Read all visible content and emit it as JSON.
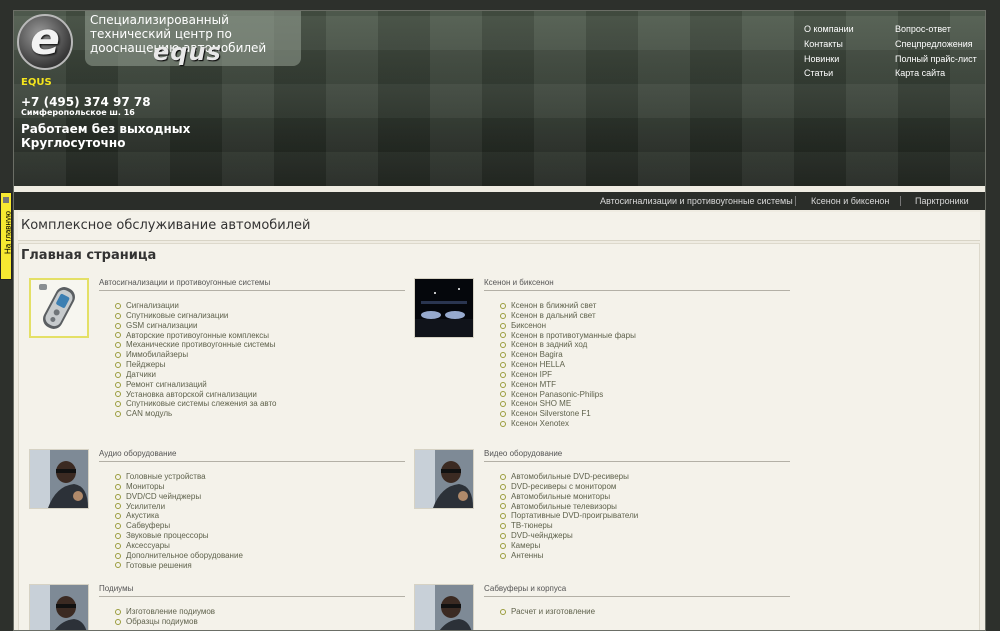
{
  "brand": {
    "logo_letter": "e",
    "tagline": "Специализированный технический центр по дооснащению автомобилей",
    "logo_word": "equs",
    "small_name": "EQUS"
  },
  "contact": {
    "phone": "+7 (495) 374 97 78",
    "address": "Симферопольское ш. 16",
    "hours_line1": "Работаем без выходных",
    "hours_line2": "Круглосуточно"
  },
  "top_nav": [
    "О компании",
    "Вопрос-ответ",
    "Контакты",
    "Спецпредложения",
    "Новинки",
    "Полный прайс-лист",
    "Статьи",
    "Карта сайта"
  ],
  "sub_nav": [
    "Автосигнализации и противоугонные системы",
    "Ксенон и биксенон",
    "Парктроники"
  ],
  "page_heading": "Комплексное обслуживание автомобилей",
  "section_title": "Главная страница",
  "side_tab": "На главную",
  "categories": [
    {
      "title": "Автосигнализации и противоугонные системы",
      "image": "alarm-keyfob-image",
      "items": [
        "Сигнализации",
        "Спутниковые сигнализации",
        "GSM сигнализации",
        "Авторские противоугонные комплексы",
        "Механические противоугонные системы",
        "Иммобилайзеры",
        "Пейджеры",
        "Датчики",
        "Ремонт сигнализаций",
        "Установка авторской сигнализации",
        "Спутниковые системы слежения за авто",
        "CAN модуль"
      ]
    },
    {
      "title": "Ксенон и биксенон",
      "image": "xenon-night-image",
      "items": [
        "Ксенон в ближний свет",
        "Ксенон в дальний свет",
        "Биксенон",
        "Ксенон в противотуманные фары",
        "Ксенон в задний ход",
        "Ксенон Bagira",
        "Ксенон HELLA",
        "Ксенон IPF",
        "Ксенон MTF",
        "Ксенон Panasonic-Philips",
        "Ксенон SHO ME",
        "Ксенон Silverstone F1",
        "Ксенон Xenotex"
      ]
    },
    {
      "title": "Аудио оборудование",
      "image": "car-technician-image",
      "items": [
        "Головные устройства",
        "Мониторы",
        "DVD/CD чейнджеры",
        "Усилители",
        "Акустика",
        "Сабвуферы",
        "Звуковые процессоры",
        "Аксессуары",
        "Дополнительное оборудование",
        "Готовые решения"
      ]
    },
    {
      "title": "Видео оборудование",
      "image": "car-technician-image",
      "items": [
        "Автомобильные DVD-ресиверы",
        "DVD-ресиверы с монитором",
        "Автомобильные мониторы",
        "Автомобильные телевизоры",
        "Портативные DVD-проигрыватели",
        "ТВ-тюнеры",
        "DVD-чейнджеры",
        "Камеры",
        "Антенны"
      ]
    },
    {
      "title": "Подиумы",
      "image": "car-technician-image",
      "items": [
        "Изготовление подиумов",
        "Образцы подиумов"
      ]
    },
    {
      "title": "Сабвуферы и корпуса",
      "image": "car-technician-image",
      "items": [
        "Расчет и изготовление"
      ]
    }
  ]
}
